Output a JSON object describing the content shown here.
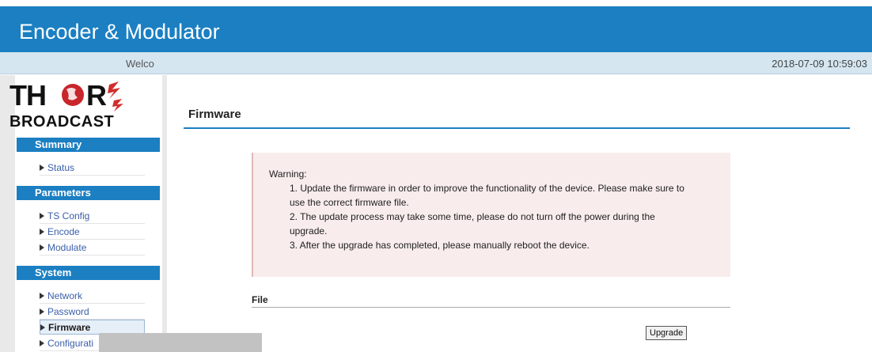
{
  "header": {
    "title": "Encoder & Modulator",
    "welcome": "Welco",
    "datetime": "2018-07-09 10:59:03"
  },
  "logo": {
    "top_text": "THOR",
    "bottom_text": "BROADCAST"
  },
  "sidebar": {
    "sections": [
      {
        "label": "Summary",
        "items": [
          {
            "label": "Status"
          }
        ]
      },
      {
        "label": "Parameters",
        "items": [
          {
            "label": "TS Config"
          },
          {
            "label": "Encode"
          },
          {
            "label": "Modulate"
          }
        ]
      },
      {
        "label": "System",
        "items": [
          {
            "label": "Network"
          },
          {
            "label": "Password"
          },
          {
            "label": "Firmware"
          },
          {
            "label": "Configurati"
          }
        ]
      }
    ],
    "active_item": "Firmware"
  },
  "main": {
    "title": "Firmware",
    "warning": {
      "heading": "Warning:",
      "line1a": "1. Update the firmware in order to improve the functionality of the device. Please make sure to",
      "line1b": "use the correct firmware file.",
      "line2a": "2. The update process may take some time, please do not turn off the power during the",
      "line2b": "upgrade.",
      "line3": "3. After the upgrade has completed, please manually reboot the device."
    },
    "file_label": "File",
    "upgrade_button": "Upgrade"
  },
  "colors": {
    "accent": "#1b7fc2",
    "warning_bg": "#f8ecec"
  }
}
